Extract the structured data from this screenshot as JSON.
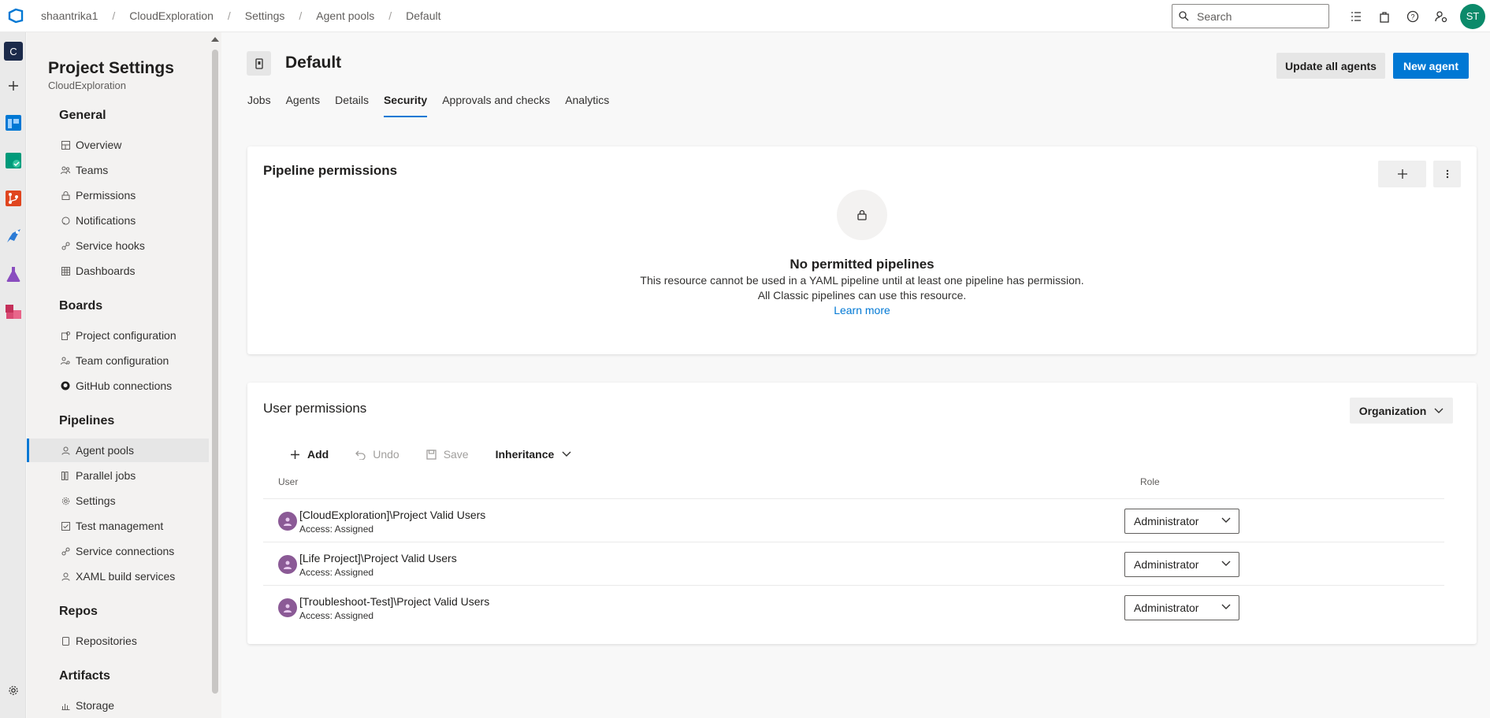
{
  "topbar": {
    "breadcrumb": [
      "shaantrika1",
      "CloudExploration",
      "Settings",
      "Agent pools",
      "Default"
    ],
    "search_placeholder": "Search",
    "avatar_initials": "ST"
  },
  "rail": {
    "project_initial": "C",
    "items": [
      "add-icon",
      "boards-icon",
      "repos-icon",
      "pipelines-icon",
      "test-plans-icon",
      "artifacts-icon"
    ]
  },
  "sidebar": {
    "title": "Project Settings",
    "subtitle": "CloudExploration",
    "sections": {
      "general": "General",
      "boards": "Boards",
      "pipelines": "Pipelines",
      "repos": "Repos",
      "artifacts": "Artifacts"
    },
    "general_items": [
      "Overview",
      "Teams",
      "Permissions",
      "Notifications",
      "Service hooks",
      "Dashboards"
    ],
    "boards_items": [
      "Project configuration",
      "Team configuration",
      "GitHub connections"
    ],
    "pipelines_items": [
      "Agent pools",
      "Parallel jobs",
      "Settings",
      "Test management",
      "Service connections",
      "XAML build services"
    ],
    "repos_items": [
      "Repositories"
    ],
    "artifacts_items": [
      "Storage"
    ]
  },
  "header": {
    "title": "Default",
    "update_label": "Update all agents",
    "new_agent_label": "New agent"
  },
  "tabs": [
    "Jobs",
    "Agents",
    "Details",
    "Security",
    "Approvals and checks",
    "Analytics"
  ],
  "pipeline_permissions": {
    "title": "Pipeline permissions",
    "empty_title": "No permitted pipelines",
    "empty_line1": "This resource cannot be used in a YAML pipeline until at least one pipeline has permission.",
    "empty_line2": "All Classic pipelines can use this resource.",
    "learn_more": "Learn more"
  },
  "user_permissions": {
    "title": "User permissions",
    "scope": "Organization",
    "toolbar": {
      "add": "Add",
      "undo": "Undo",
      "save": "Save",
      "inheritance": "Inheritance"
    },
    "columns": {
      "user": "User",
      "role": "Role"
    },
    "rows": [
      {
        "name": "[CloudExploration]\\Project Valid Users",
        "access": "Access: Assigned",
        "role": "Administrator"
      },
      {
        "name": "[Life Project]\\Project Valid Users",
        "access": "Access: Assigned",
        "role": "Administrator"
      },
      {
        "name": "[Troubleshoot-Test]\\Project Valid Users",
        "access": "Access: Assigned",
        "role": "Administrator"
      }
    ]
  },
  "colors": {
    "accent": "#0078d4",
    "avatar": "#0b8a6a"
  }
}
